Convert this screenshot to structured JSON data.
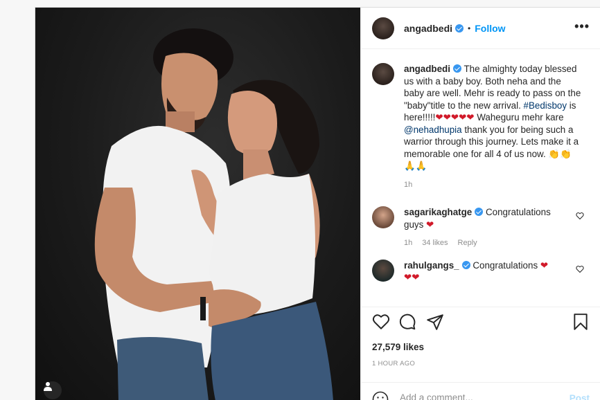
{
  "post": {
    "username": "angadbedi",
    "follow_label": "Follow",
    "more_label": "•••",
    "dot": "•"
  },
  "caption": {
    "username": "angadbedi",
    "text_1": " The almighty today blessed us with a baby boy. Both neha and the baby are well. Mehr is ready to pass on the \"baby\"title to the new arrival. ",
    "hashtag": "#Bedisboy",
    "text_2": " is here!!!!!",
    "hearts": "❤❤❤❤❤",
    "text_3": " Waheguru mehr kare ",
    "mention": "@nehadhupia",
    "text_4": " thank you for being such a warrior through this journey. Lets make it a memorable one for all 4 of us now. ",
    "emoji_1": "👏👏",
    "emoji_2": "🙏🙏",
    "time": "1h"
  },
  "comments": [
    {
      "username": "sagarikaghatge",
      "text": " Congratulations guys ",
      "heart": "❤",
      "time": "1h",
      "likes": "34 likes",
      "reply": "Reply"
    },
    {
      "username": "rahulgangs_",
      "text": " Congratulations ",
      "heart": "❤",
      "hearts_2": "❤❤"
    }
  ],
  "stats": {
    "likes": "27,579 likes",
    "time": "1 HOUR AGO"
  },
  "add_comment": {
    "placeholder": "Add a comment...",
    "post_label": "Post"
  },
  "icons": {
    "like": "heart-outline-icon",
    "comment": "speech-bubble-icon",
    "share": "paper-plane-icon",
    "save": "bookmark-icon",
    "emoji": "smiley-icon",
    "user_tag": "person-icon"
  },
  "colors": {
    "link": "#00376b",
    "follow": "#0095f6",
    "verified": "#3897f0",
    "post_disabled": "#b2dffc",
    "meta": "#8e8e8e"
  }
}
